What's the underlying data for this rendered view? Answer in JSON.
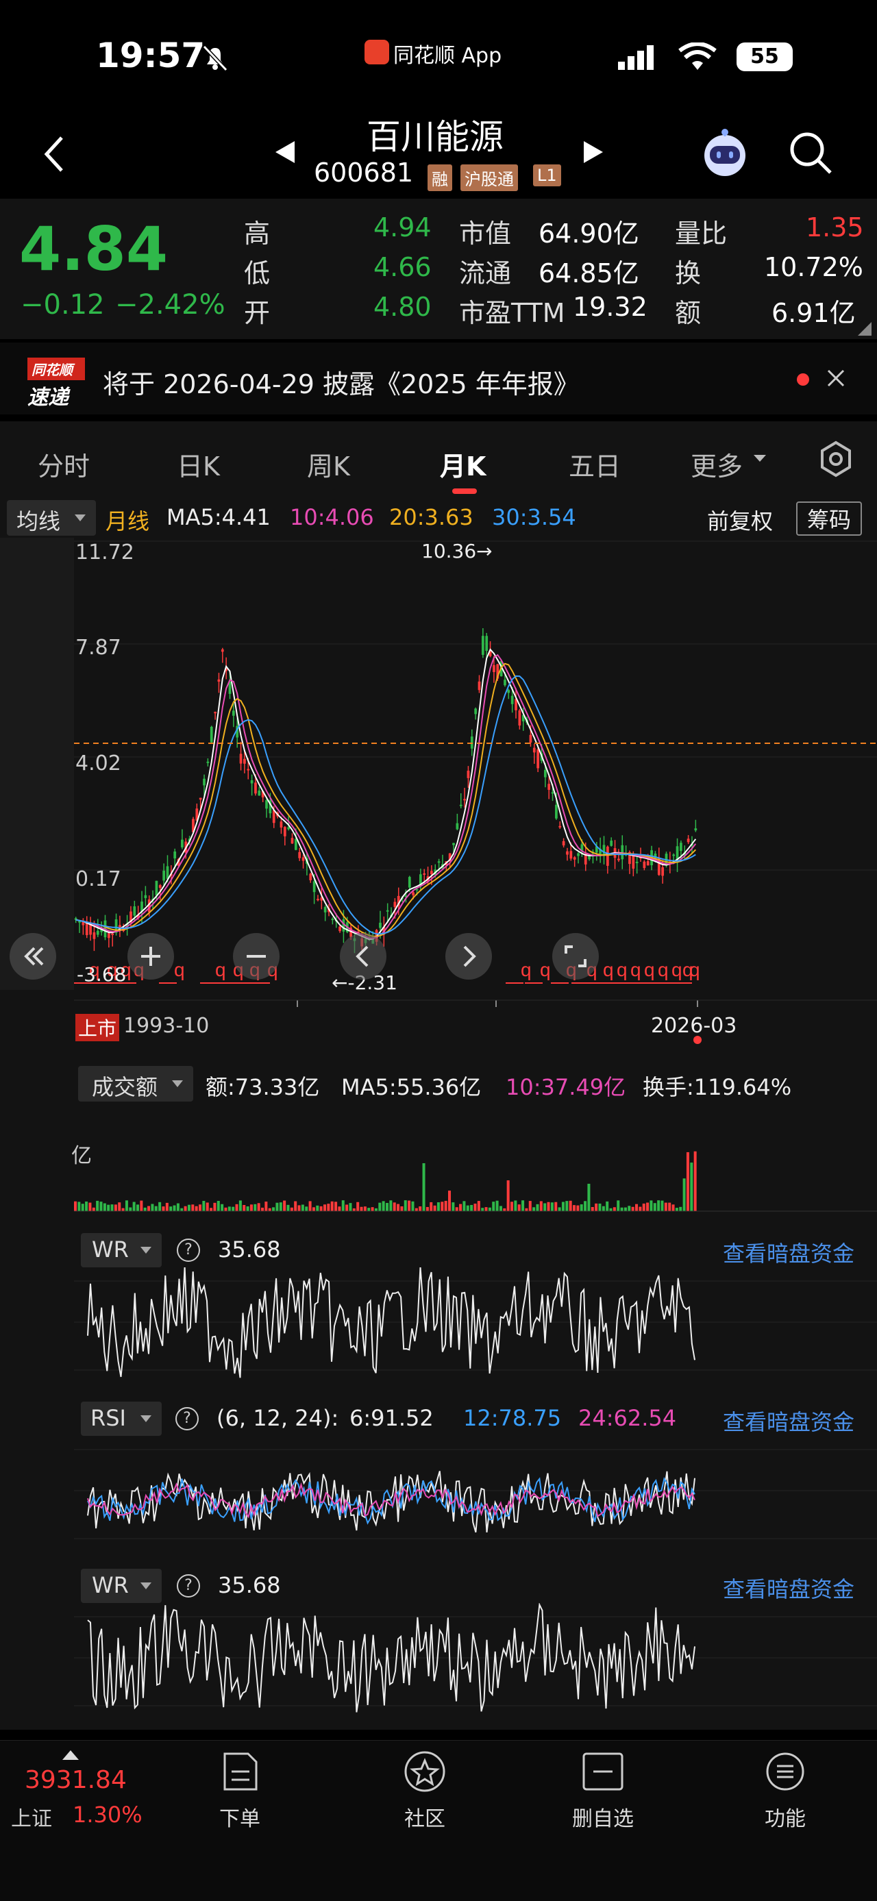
{
  "status_bar": {
    "time": "19:57",
    "app_label": "同花顺 App",
    "battery": "55"
  },
  "stock": {
    "name": "百川能源",
    "code": "600681",
    "badges": [
      "融",
      "沪股通",
      "L1"
    ]
  },
  "quote": {
    "price": "4.84",
    "change": "−0.12",
    "change_pct": "−2.42%",
    "high_label": "高",
    "high": "4.94",
    "low_label": "低",
    "low": "4.66",
    "open_label": "开",
    "open": "4.80",
    "mktcap_label": "市值",
    "mktcap": "64.90亿",
    "float_label": "流通",
    "float": "64.85亿",
    "pe_label": "市盈TTM",
    "pe": "19.32",
    "vol_ratio_label": "量比",
    "vol_ratio": "1.35",
    "turnover_label": "换",
    "turnover": "10.72%",
    "amount_label": "额",
    "amount": "6.91亿"
  },
  "banner": {
    "logo_top": "同花顺",
    "logo_bottom": "速递",
    "text": "将于 2026-04-29 披露《2025 年年报》"
  },
  "tabs": [
    "分时",
    "日K",
    "周K",
    "月K",
    "五日",
    "更多"
  ],
  "active_tab": "月K",
  "ma_bar": {
    "selector": "均线",
    "period": "月线",
    "ma5": "MA5:4.41",
    "ma10": "10:4.06",
    "ma20": "20:3.63",
    "ma30": "30:3.54",
    "adjust": "前复权",
    "chips": "筹码"
  },
  "chart_data": {
    "type": "candlestick",
    "y_ticks": [
      "11.72",
      "7.87",
      "4.02",
      "0.17"
    ],
    "high_marker": "10.36→",
    "low_marker": "←-2.31",
    "low_left": "-3.68",
    "start_label": "上市",
    "start_date": "1993-10",
    "end_date": "2026-03",
    "current_price_line": 4.84,
    "series": [
      {
        "name": "MA5",
        "color": "#ffffff"
      },
      {
        "name": "10",
        "color": "#e84cb4"
      },
      {
        "name": "20",
        "color": "#f0b020"
      },
      {
        "name": "30",
        "color": "#3aa0ff"
      }
    ]
  },
  "volume_panel": {
    "selector": "成交额",
    "amount": "额:73.33亿",
    "ma5": "MA5:55.36亿",
    "ma10": "10:37.49亿",
    "turnover": "换手:119.64%",
    "unit": "亿"
  },
  "wr_panel_1": {
    "selector": "WR",
    "value": "35.68",
    "link": "查看暗盘资金"
  },
  "rsi_panel": {
    "selector": "RSI",
    "params": "(6, 12, 24):",
    "rsi6": "6:91.52",
    "rsi12": "12:78.75",
    "rsi24": "24:62.54",
    "link": "查看暗盘资金"
  },
  "wr_panel_2": {
    "selector": "WR",
    "value": "35.68",
    "link": "查看暗盘资金"
  },
  "bottom_bar": {
    "index_value": "3931.84",
    "index_name": "上证",
    "index_pct": "1.30%",
    "items": [
      "下单",
      "社区",
      "删自选",
      "功能"
    ]
  }
}
